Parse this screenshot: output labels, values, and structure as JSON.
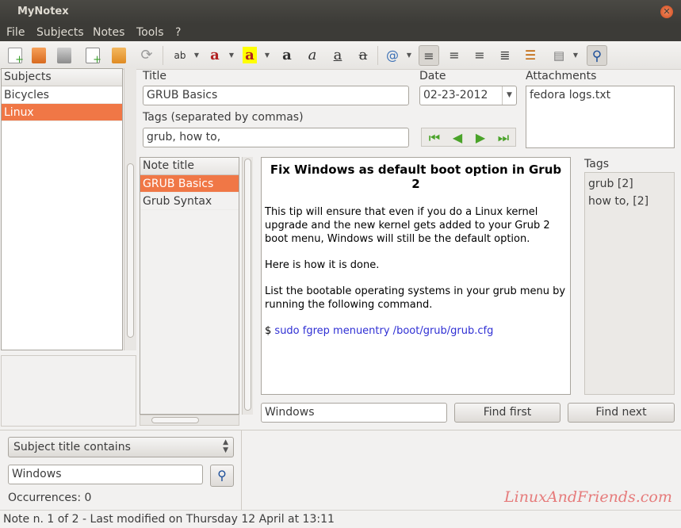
{
  "window": {
    "title": "MyNotex"
  },
  "menu": [
    "File",
    "Subjects",
    "Notes",
    "Tools",
    "?"
  ],
  "subjects": {
    "header": "Subjects",
    "items": [
      "Bicycles",
      "Linux"
    ],
    "selected": 1
  },
  "note_form": {
    "title_label": "Title",
    "title_value": "GRUB Basics",
    "date_label": "Date",
    "date_value": "02-23-2012",
    "attachments_label": "Attachments",
    "attachments": [
      "fedora logs.txt"
    ],
    "tags_label": "Tags (separated by commas)",
    "tags_value": "grub, how to,"
  },
  "notes_list": {
    "header": "Note title",
    "items": [
      "GRUB Basics",
      "Grub Syntax"
    ],
    "selected": 0
  },
  "editor": {
    "heading": "Fix Windows as default boot option in Grub 2",
    "p1": "This tip will ensure that even if you do a Linux kernel upgrade and the new kernel gets added to your Grub 2 boot menu, Windows will still be the default option.",
    "p2": "Here is how it is done.",
    "p3": "List the bootable operating systems in your grub menu by running the following command.",
    "cmd_prompt": "$",
    "cmd": "sudo fgrep menuentry /boot/grub/grub.cfg"
  },
  "tags_panel": {
    "header": "Tags",
    "items": [
      "grub [2]",
      "how to, [2]"
    ]
  },
  "find": {
    "value": "Windows",
    "find_first": "Find first",
    "find_next": "Find next"
  },
  "search": {
    "mode": "Subject title contains",
    "value": "Windows",
    "occurrences": "Occurrences: 0"
  },
  "watermark": "LinuxAndFriends.com",
  "status": "Note n. 1 of 2 - Last modified on Thursday 12 April at 13:11",
  "colors": {
    "selection": "#f07746",
    "titlebar": "#3c3b37",
    "accent_blue": "#2f2fd4"
  }
}
